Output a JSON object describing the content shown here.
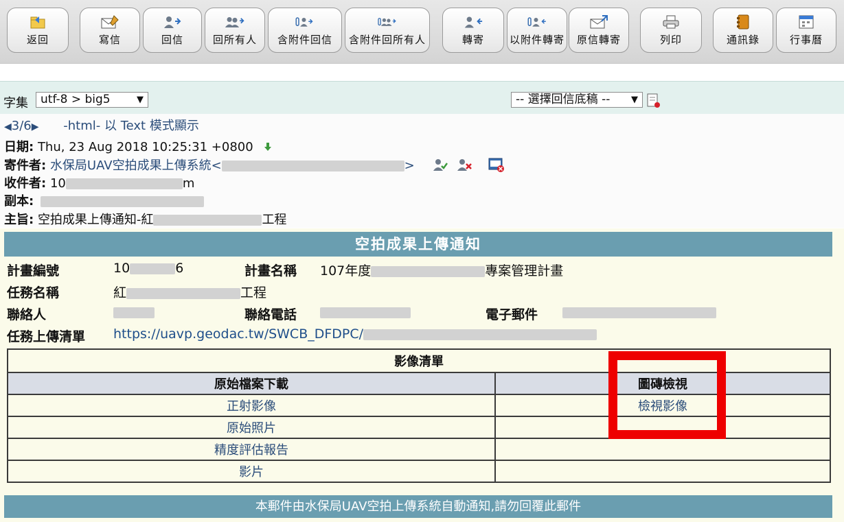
{
  "toolbar": {
    "buttons": [
      {
        "label": "返回",
        "icon": "folder-back-icon"
      },
      {
        "label": "寫信",
        "icon": "compose-icon"
      },
      {
        "label": "回信",
        "icon": "reply-icon"
      },
      {
        "label": "回所有人",
        "icon": "reply-all-icon"
      },
      {
        "label": "含附件回信",
        "icon": "reply-with-attachment-icon"
      },
      {
        "label": "含附件回所有人",
        "icon": "reply-all-with-attachment-icon"
      },
      {
        "label": "轉寄",
        "icon": "forward-icon"
      },
      {
        "label": "以附件轉寄",
        "icon": "forward-as-attachment-icon"
      },
      {
        "label": "原信轉寄",
        "icon": "forward-original-icon"
      },
      {
        "label": "列印",
        "icon": "print-icon"
      },
      {
        "label": "通訊錄",
        "icon": "address-book-icon"
      },
      {
        "label": "行事曆",
        "icon": "calendar-icon"
      }
    ]
  },
  "charset": {
    "label": "字集",
    "value": "utf-8 > big5",
    "template_value": "-- 選擇回信底稿 --"
  },
  "nav": {
    "position": "3/6",
    "mode_text": "-html- 以 Text 模式顯示"
  },
  "header": {
    "date_label": "日期:",
    "date_value": "Thu, 23 Aug 2018 10:25:31 +0800",
    "from_label": "寄件者:",
    "from_name": "水保局UAV空拍成果上傳系統<",
    "from_end": ">",
    "to_label": "收件者:",
    "to_prefix": "10",
    "to_suffix": "m",
    "cc_label": "副本:",
    "subject_label": "主旨:",
    "subject_prefix": "空拍成果上傳通知-紅",
    "subject_suffix": "工程"
  },
  "mail": {
    "banner": "空拍成果上傳通知",
    "plan_no_label": "計畫編號",
    "plan_no_prefix": "10",
    "plan_no_suffix": "6",
    "plan_name_label": "計畫名稱",
    "plan_name_prefix": "107年度",
    "plan_name_suffix": "專案管理計畫",
    "task_name_label": "任務名稱",
    "task_name_prefix": "紅",
    "task_name_suffix": "工程",
    "contact_label": "聯絡人",
    "phone_label": "聯絡電話",
    "email_label": "電子郵件",
    "upload_list_label": "任務上傳清單",
    "upload_list_url": "https://uavp.geodac.tw/SWCB_DFDPC/",
    "table_title": "影像清單",
    "col_download": "原始檔案下載",
    "col_view": "圖磚檢視",
    "rows": [
      {
        "download": "正射影像",
        "view": "檢視影像"
      },
      {
        "download": "原始照片",
        "view": ""
      },
      {
        "download": "精度評估報告",
        "view": ""
      },
      {
        "download": "影片",
        "view": ""
      }
    ],
    "footer": "本郵件由水保局UAV空拍上傳系統自動通知,請勿回覆此郵件"
  },
  "colors": {
    "banner": "#6a9eb0",
    "highlight": "#ee0000",
    "link": "#2b4d7a"
  }
}
